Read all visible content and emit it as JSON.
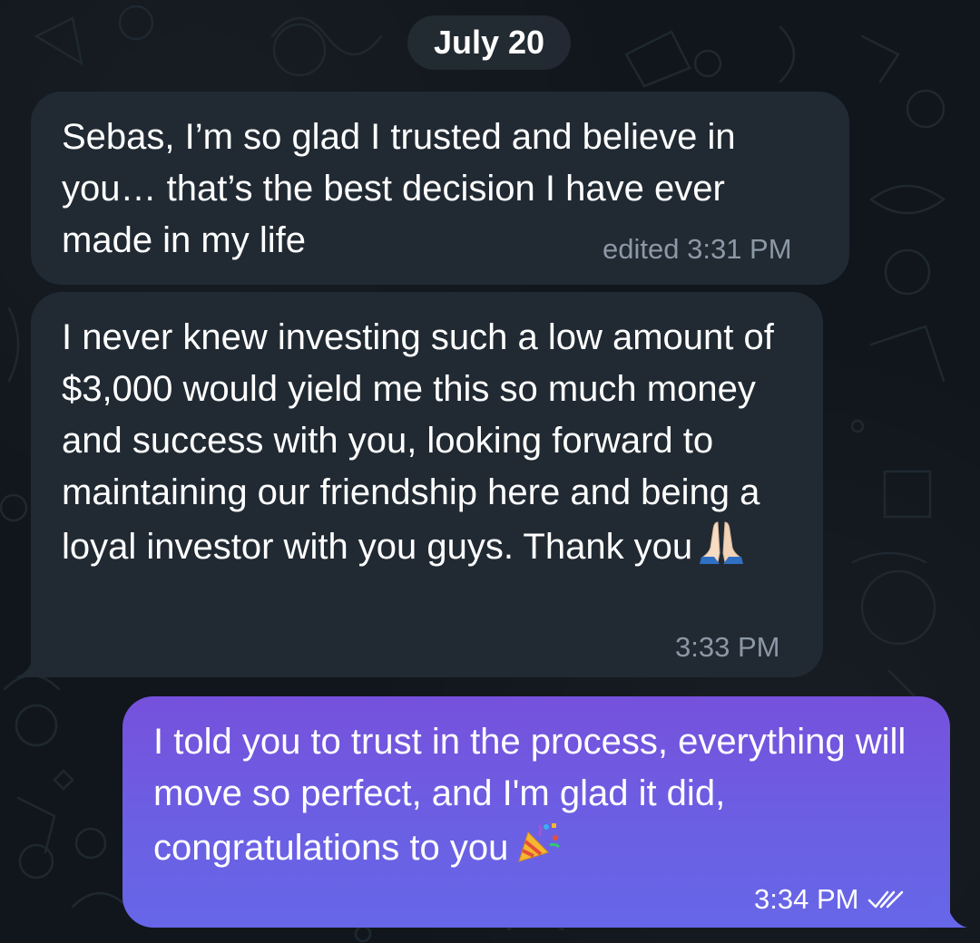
{
  "date_separator": "July 20",
  "messages": [
    {
      "direction": "incoming",
      "text": "Sebas, I’m so glad I trusted and believe in you… that’s the best decision I have ever made in my life",
      "edited_label": "edited",
      "time": "3:31 PM"
    },
    {
      "direction": "incoming",
      "text": "I never knew investing such a low amount of $3,000 would yield me this so much money and success with you, looking forward to maintaining our friendship here and being a loyal investor with you guys. Thank you",
      "emoji": "folded-hands",
      "time": "3:33 PM"
    },
    {
      "direction": "outgoing",
      "text": "I told you to trust in the process, everything will move so perfect, and I'm glad it did, congratulations to you",
      "emoji": "party-popper",
      "time": "3:34 PM",
      "status_icon": "double-check-icon"
    }
  ],
  "colors": {
    "background": "#10161c",
    "incoming_bubble": "#212a33",
    "outgoing_bubble_top": "#7651dc",
    "outgoing_bubble_bottom": "#6766e8",
    "meta_incoming": "#8c98a5",
    "date_pill": "#28303a"
  }
}
